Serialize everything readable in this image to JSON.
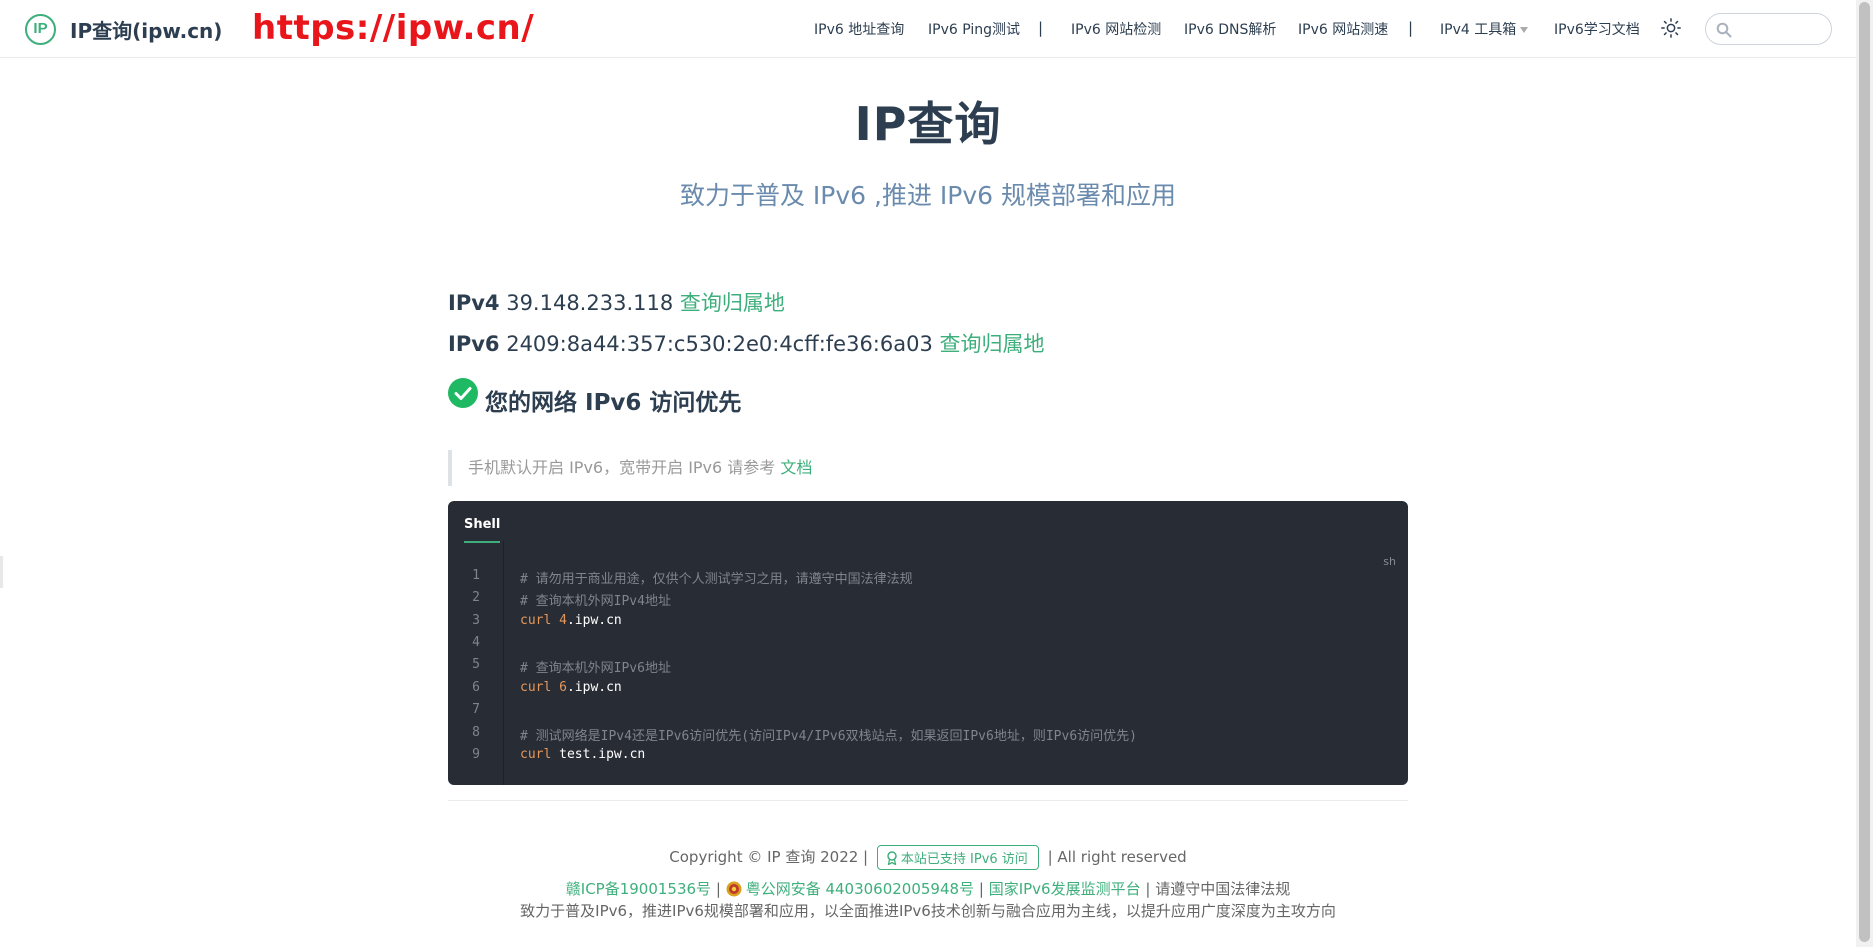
{
  "header": {
    "logo_text": "IP",
    "site_name": "IP查询(ipw.cn)",
    "watermark": "https://ipw.cn/",
    "nav": [
      {
        "label": "IPv6 地址查询"
      },
      {
        "label": "IPv6 Ping测试"
      },
      {
        "label": "IPv6 网站检测"
      },
      {
        "label": "IPv6 DNS解析"
      },
      {
        "label": "IPv6 网站测速"
      },
      {
        "label": "IPv4 工具箱"
      },
      {
        "label": "IPv6学习文档"
      }
    ],
    "separator": "|",
    "search_placeholder": ""
  },
  "hero": {
    "title": "IP查询",
    "description": "致力于普及 IPv6 ,推进 IPv6 规模部署和应用"
  },
  "ip": {
    "v4_label": "IPv4",
    "v4_value": "39.148.233.118",
    "v6_label": "IPv6",
    "v6_value": "2409:8a44:357:c530:2e0:4cff:fe36:6a03",
    "lookup_link": "查询归属地"
  },
  "priority_text": "您的网络 IPv6 访问优先",
  "tip": {
    "text": "手机默认开启 IPv6，宽带开启 IPv6 请参考",
    "link": "文档"
  },
  "code": {
    "tab": "Shell",
    "lang": "sh",
    "lines": [
      {
        "num": "1",
        "comment": "# 请勿用于商业用途，仅供个人测试学习之用，请遵守中国法律法规"
      },
      {
        "num": "2",
        "comment": "# 查询本机外网IPv4地址"
      },
      {
        "num": "3",
        "cmd": "curl",
        "arg_num": "4",
        "arg": ".ipw.cn"
      },
      {
        "num": "4"
      },
      {
        "num": "5",
        "comment": "# 查询本机外网IPv6地址"
      },
      {
        "num": "6",
        "cmd": "curl",
        "arg_num": "6",
        "arg": ".ipw.cn"
      },
      {
        "num": "7"
      },
      {
        "num": "8",
        "comment": "# 测试网络是IPv4还是IPv6访问优先(访问IPv4/IPv6双栈站点，如果返回IPv6地址，则IPv6访问优先)"
      },
      {
        "num": "9",
        "cmd": "curl",
        "arg": "test.ipw.cn"
      }
    ]
  },
  "footer": {
    "copyright_left": "Copyright © IP 查询 2022 |",
    "badge": "本站已支持 IPv6 访问",
    "copyright_right": "| All right reserved",
    "icp": "赣ICP备19001536号",
    "sep": "|",
    "police": "粤公网安备 44030602005948号",
    "platform": "国家IPv6发展监测平台",
    "law": "请遵守中国法律法规",
    "mission": "致力于普及IPv6，推进IPv6规模部署和应用，以全面推进IPv6技术创新与融合应用为主线，以提升应用广度深度为主攻方向"
  },
  "colors": {
    "accent": "#3eaf7c",
    "text": "#2c3e50",
    "watermark": "#e8151b",
    "code_bg": "#282c34"
  }
}
